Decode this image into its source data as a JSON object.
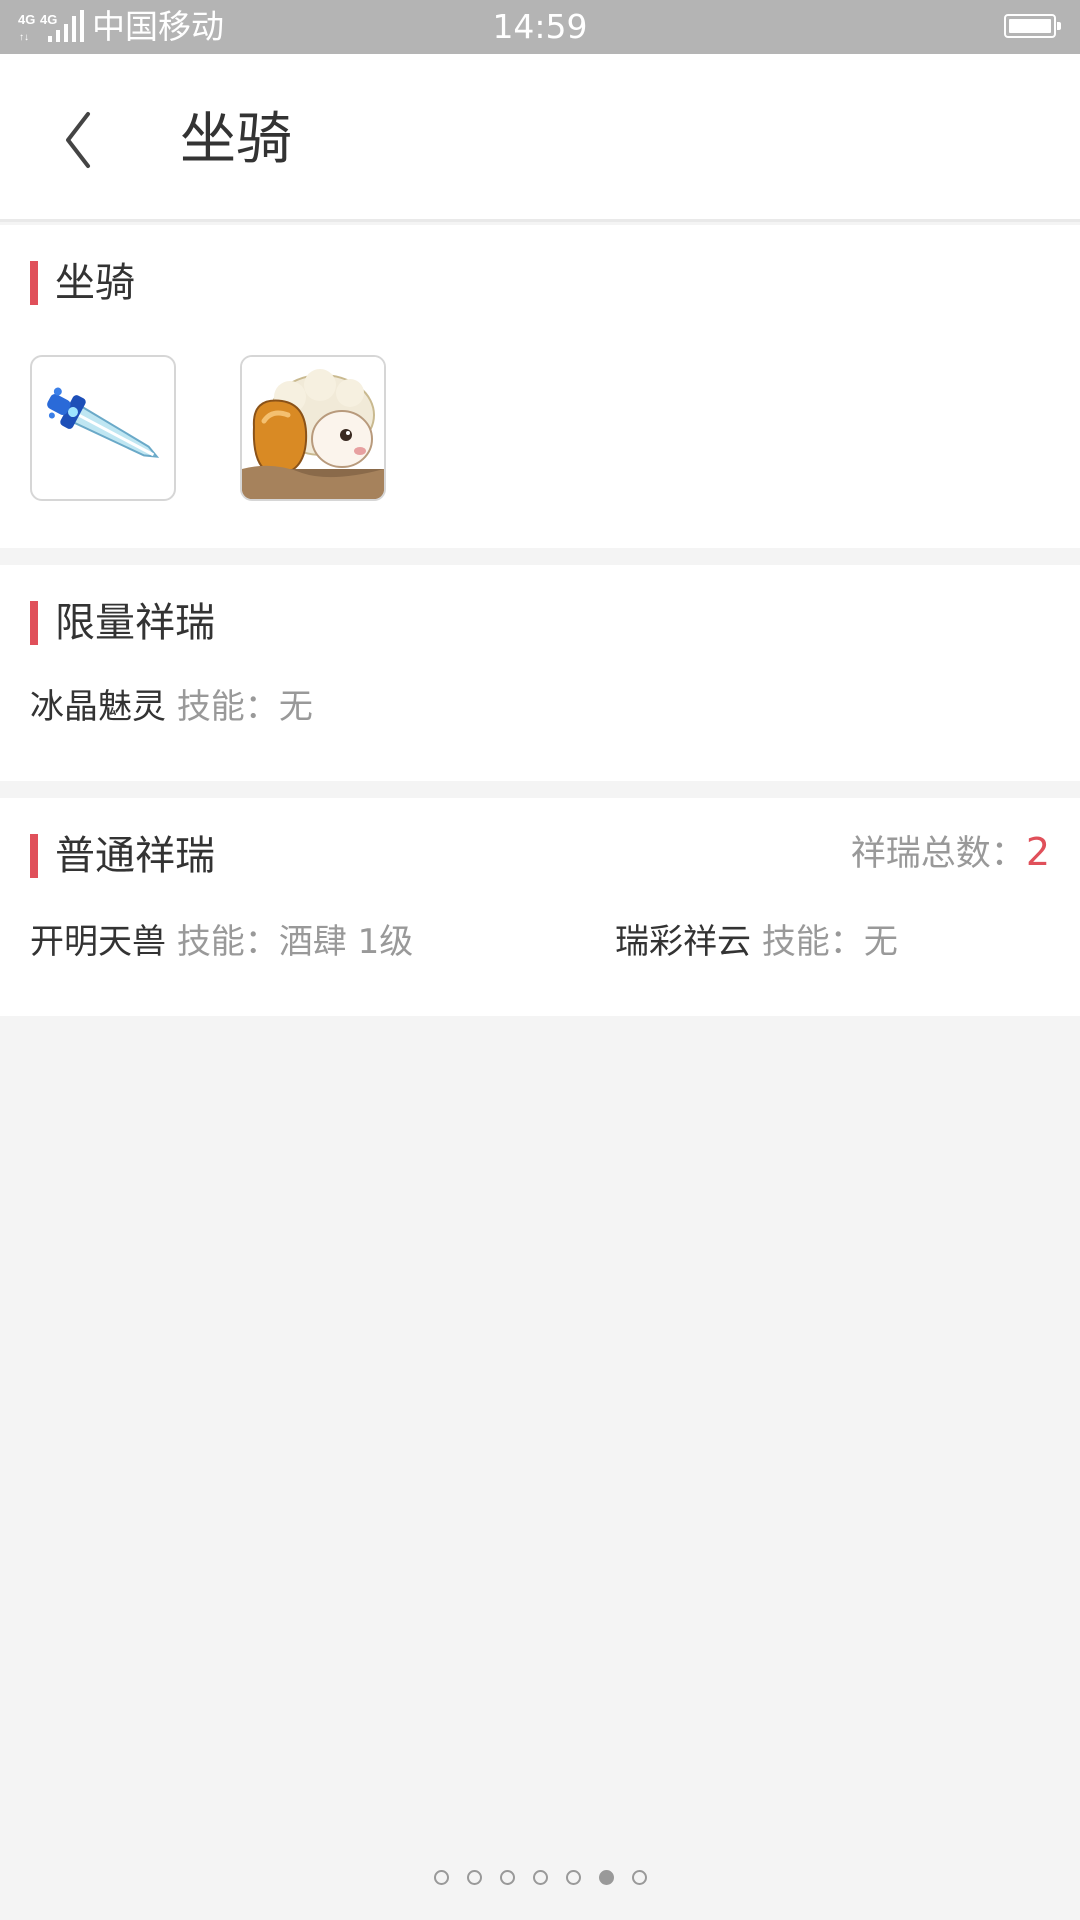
{
  "status_bar": {
    "network": "4G 4G",
    "carrier": "中国移动",
    "time": "14:59"
  },
  "header": {
    "back_icon": "chevron-left-icon",
    "title": "坐骑"
  },
  "mounts": {
    "title": "坐骑",
    "items": [
      {
        "icon": "ice-sword-mount-icon"
      },
      {
        "icon": "sheep-mount-icon"
      }
    ]
  },
  "limited": {
    "title": "限量祥瑞",
    "items": [
      {
        "name": "冰晶魅灵",
        "skill_label": "技能：",
        "skill": "无"
      }
    ]
  },
  "normal": {
    "title": "普通祥瑞",
    "total_label": "祥瑞总数：",
    "total_value": "2",
    "items": [
      {
        "name": "开明天兽",
        "skill_label": "技能：",
        "skill": "酒肆 1级"
      },
      {
        "name": "瑞彩祥云",
        "skill_label": "技能：",
        "skill": "无"
      }
    ]
  },
  "pagination": {
    "total": 7,
    "active_index": 5
  },
  "colors": {
    "accent": "#e0505a",
    "status_bar": "#b4b4b4",
    "background": "#f4f4f4"
  }
}
